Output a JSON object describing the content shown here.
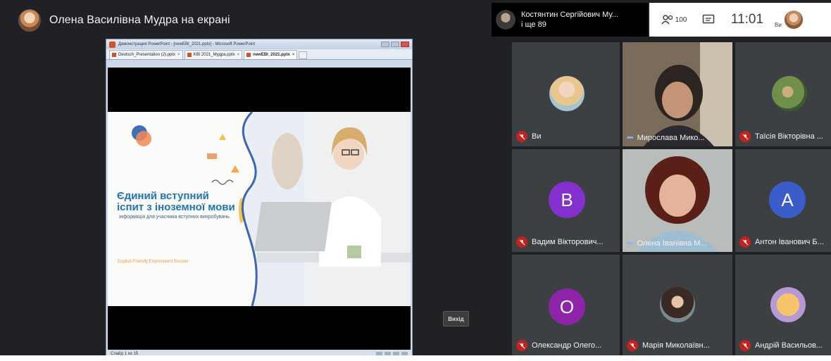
{
  "presenter": {
    "name": "Олена Василівна Мудра на екрані"
  },
  "presentation": {
    "window_title": "Демонстрация PowerPoint - [newEBI_2021.pptx] - Microsoft PowerPoint",
    "tabs": [
      {
        "label": "Deutsch_Presentation (2).pptx"
      },
      {
        "label": "KBI 2021_Мудра.pptx"
      },
      {
        "label": "newEBI_2021.pptx"
      }
    ],
    "slide_title": "Єдиний вступний іспит з іноземної мови",
    "slide_subtitle": "інформація для учасника вступних випробувань",
    "slide_footer": "English-Friendly Environment Booster",
    "status": "Слайд 1 из 15"
  },
  "exit_button": {
    "label": "Вихід"
  },
  "speaker": {
    "name": "Костянтин Сергійович Му...",
    "more": "і ще 89"
  },
  "controls": {
    "participants_count": "100",
    "clock": "11:01",
    "you_label": "Ви"
  },
  "participants": [
    {
      "name": "Ви",
      "muted": true
    },
    {
      "name": "Мирослава Мико...",
      "muted": false
    },
    {
      "name": "Таїсія Вікторівна ...",
      "muted": true
    },
    {
      "name": "Вадим Вікторович...",
      "muted": true,
      "initial": "В"
    },
    {
      "name": "Олена Іванівна М...",
      "muted": false
    },
    {
      "name": "Антон Іванович Б...",
      "muted": true,
      "initial": "А"
    },
    {
      "name": "Олександр Олего...",
      "muted": true,
      "initial": "О"
    },
    {
      "name": "Марія Миколаївн...",
      "muted": true
    },
    {
      "name": "Андрій Васильов...",
      "muted": true
    }
  ],
  "colors": {
    "muted": "#c5221f",
    "av_v": "#8430ce",
    "av_a": "#3b5dc9",
    "av_o": "#8e24aa"
  }
}
